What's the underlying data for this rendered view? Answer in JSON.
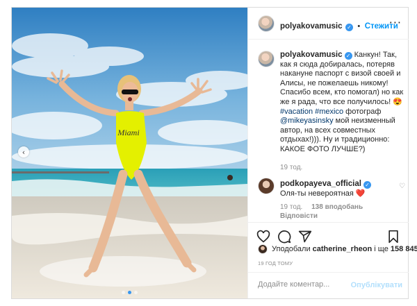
{
  "post": {
    "username": "polyakovamusic",
    "verified_icon": "verified-badge-icon",
    "follow_separator": "•",
    "follow_label": "Стежити",
    "more_icon": "more-options-icon",
    "caption": {
      "text_1": "Канкун! Так, как я сюда добиралась, потеряв накануне паспорт с визой своей и Алисы, не пожелаешь никому! Спасибо всем, кто помогал) но как же я рада, что все получилось! 😍 ",
      "tag_vacation": "#vacation",
      "text_2": " ",
      "tag_mexico": "#mexico",
      "text_3": " фотограф ",
      "mention": "@mikeyasinsky",
      "text_4": " мой неизменный автор, на всех совместных отдыхах!))). Ну и традиционно: КАКОЕ ФОТО ЛУЧШЕ?)",
      "time_ago": "19 тод."
    },
    "comment": {
      "username": "podkopayeva_official",
      "text": " Оля-ты невероятная ❤️",
      "time_ago": "19 тод.",
      "likes": "138 вподобань",
      "reply_label": "Відповісти"
    },
    "likes": {
      "prefix": "Уподобали ",
      "user": "catherine_rheon",
      "middle": " і ще ",
      "count": "158 845"
    },
    "date": "19 ГОД ТОМУ",
    "comment_input_placeholder": "Додайте коментар...",
    "publish_label": "Опублікувати"
  },
  "icons": {
    "like": "heart-icon",
    "comment": "comment-icon",
    "share": "share-icon",
    "save": "bookmark-icon",
    "prev": "chevron-left-icon"
  },
  "colors": {
    "link": "#0095f6",
    "hashtag": "#00376b",
    "muted": "#8e8e8e",
    "border": "#dbdbdb",
    "swimsuit": "#e4f000"
  }
}
